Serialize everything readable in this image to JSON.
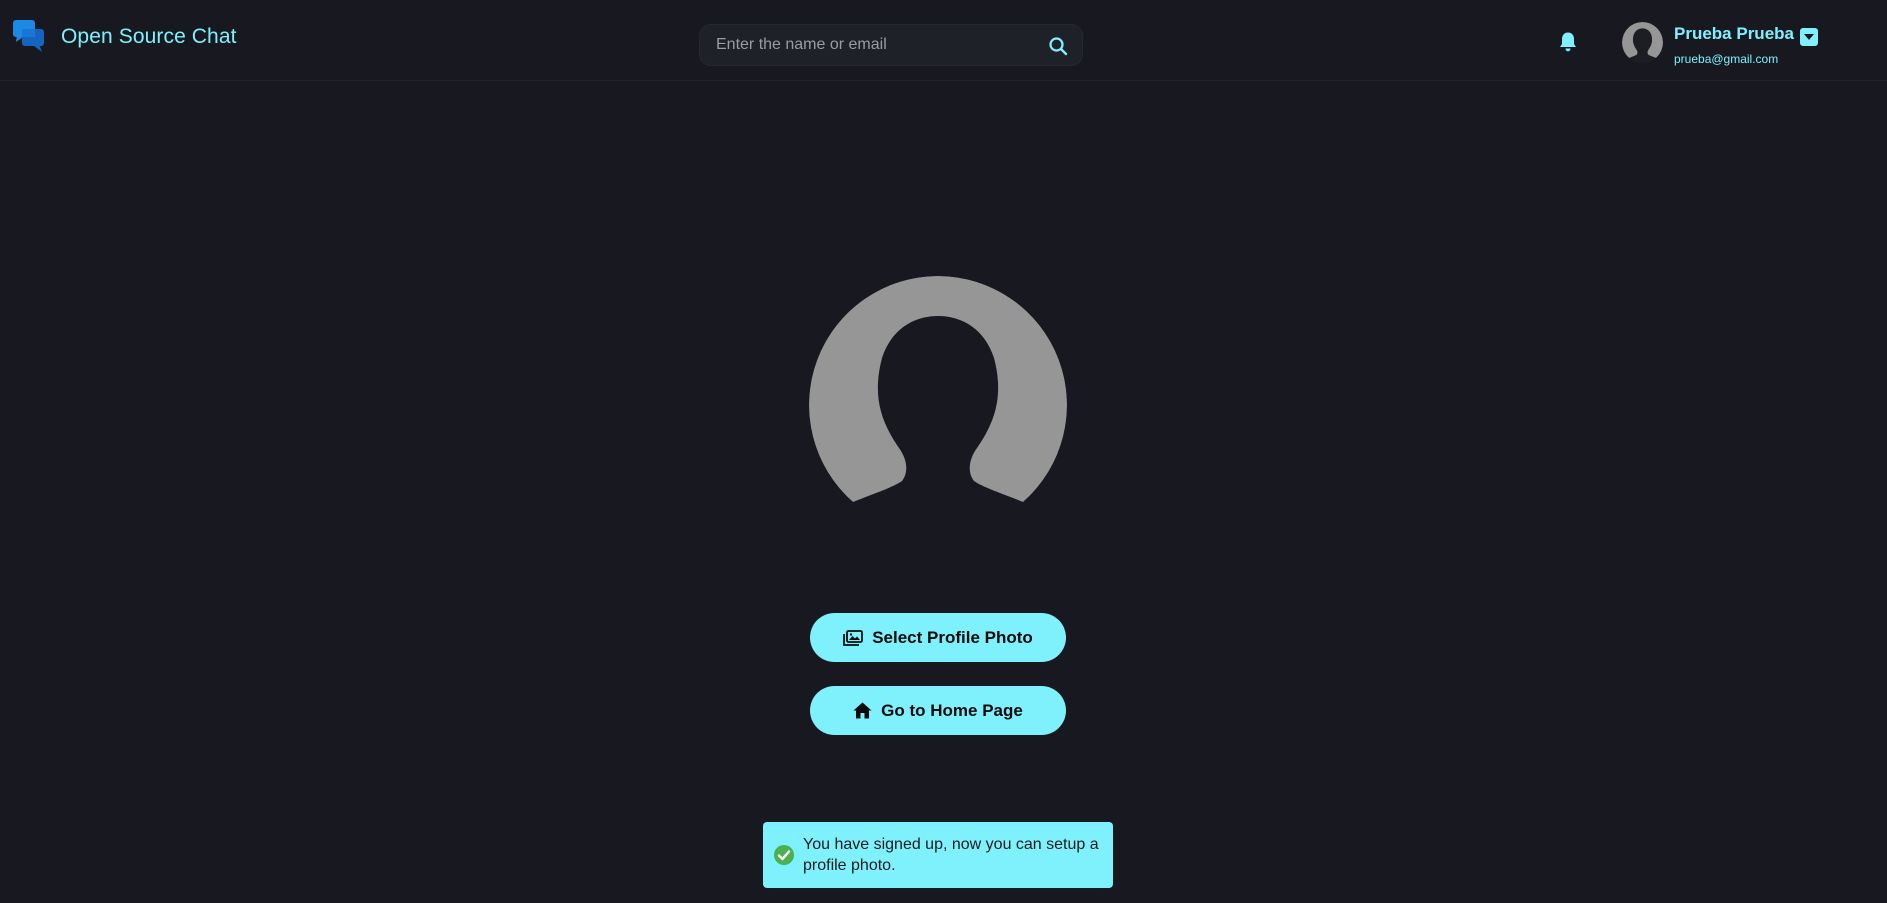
{
  "header": {
    "app_title": "Open Source Chat",
    "logo_icon": "chat-bubbles-icon",
    "search": {
      "placeholder": "Enter the name or email",
      "value": "",
      "icon": "search-icon"
    },
    "notifications_icon": "bell-icon",
    "user": {
      "name": "Prueba Prueba",
      "email": "prueba@gmail.com",
      "avatar_icon": "default-avatar-icon",
      "menu_icon": "caret-down-icon"
    }
  },
  "main": {
    "avatar_icon": "default-avatar-icon",
    "select_photo_button": {
      "label": "Select Profile Photo",
      "icon": "images-icon"
    },
    "home_button": {
      "label": "Go to Home Page",
      "icon": "home-icon"
    }
  },
  "toast": {
    "message": "You have signed up, now you can setup a profile photo.",
    "icon": "check-circle-icon",
    "status": "success"
  },
  "colors": {
    "background": "#181920",
    "accent": "#7ef1fd",
    "logo": "#1e88e5",
    "avatar": "#969696",
    "success": "#4caf50"
  }
}
